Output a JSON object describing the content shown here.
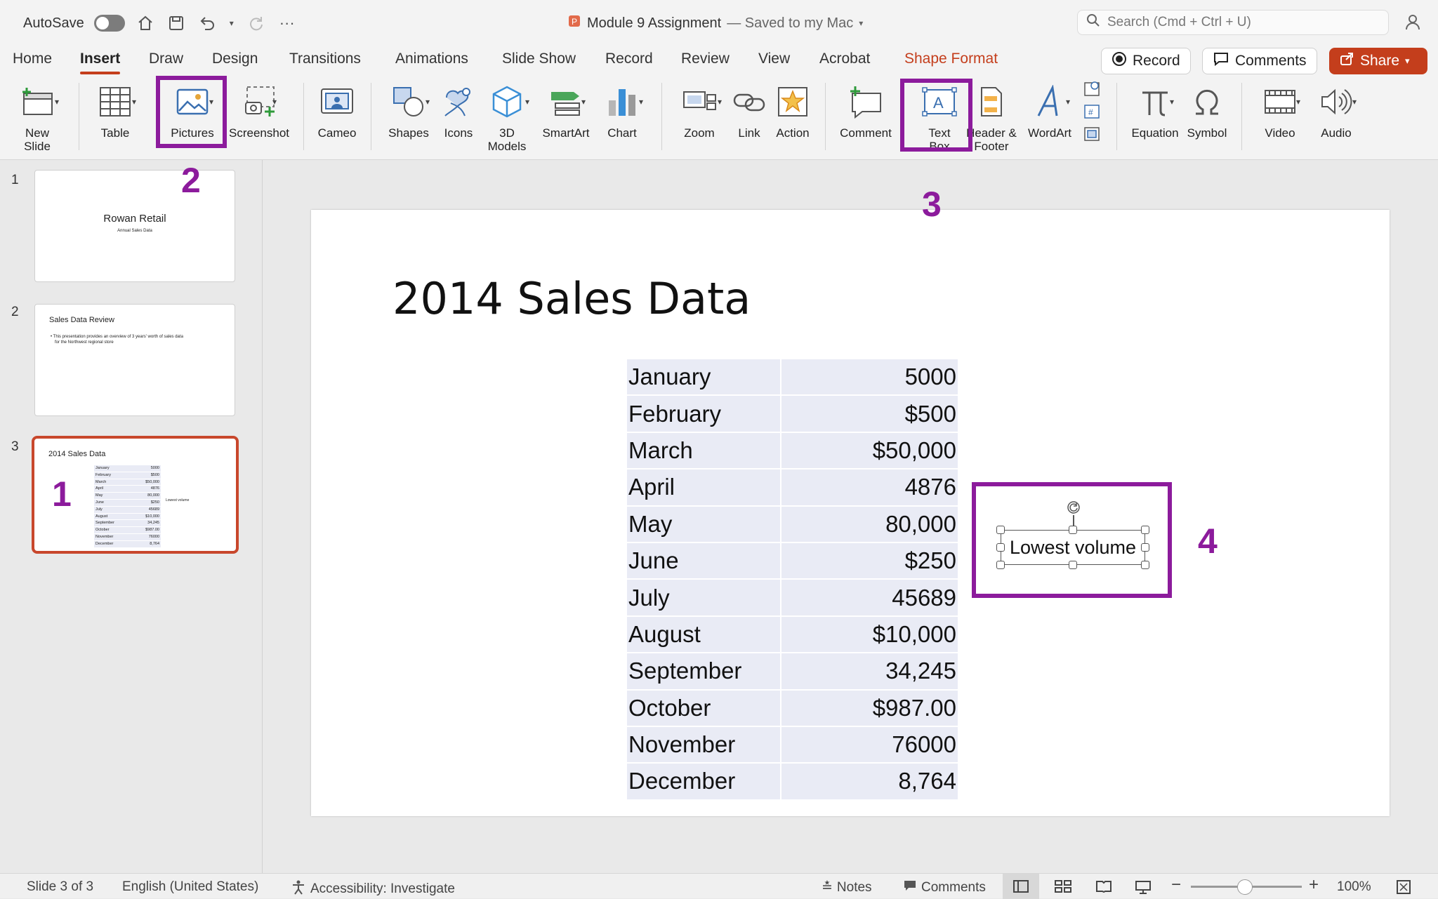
{
  "titlebar": {
    "autosave_label": "AutoSave",
    "doc_name": "Module 9 Assignment",
    "doc_status": "— Saved to my Mac",
    "search_placeholder": "Search (Cmd + Ctrl + U)"
  },
  "tabs": [
    "Home",
    "Insert",
    "Draw",
    "Design",
    "Transitions",
    "Animations",
    "Slide Show",
    "Record",
    "Review",
    "View",
    "Acrobat",
    "Shape Format"
  ],
  "active_tab": "Insert",
  "top_buttons": {
    "record": "Record",
    "comments": "Comments",
    "share": "Share"
  },
  "ribbon": {
    "new_slide": [
      "New",
      "Slide"
    ],
    "table": "Table",
    "pictures": "Pictures",
    "screenshot": "Screenshot",
    "cameo": "Cameo",
    "shapes": "Shapes",
    "icons": "Icons",
    "models": [
      "3D",
      "Models"
    ],
    "smartart": "SmartArt",
    "chart": "Chart",
    "zoom": "Zoom",
    "link": "Link",
    "action": "Action",
    "comment": "Comment",
    "textbox": [
      "Text",
      "Box"
    ],
    "header_footer": [
      "Header &",
      "Footer"
    ],
    "wordart": "WordArt",
    "equation": "Equation",
    "symbol": "Symbol",
    "video": "Video",
    "audio": "Audio"
  },
  "annotations": [
    "1",
    "2",
    "3",
    "4"
  ],
  "annotation_color": "#8c1b9c",
  "thumbnails": [
    {
      "num": "1",
      "title": "Rowan Retail",
      "subtitle": "Annual Sales Data"
    },
    {
      "num": "2",
      "title": "Sales Data Review",
      "bullet": "• This presentation provides an overview of 3 years' worth of sales data",
      "bullet2": "for the Northwest regional store"
    },
    {
      "num": "3",
      "title": "2014 Sales Data",
      "side": "Lowest volume"
    }
  ],
  "slide": {
    "title": "2014 Sales Data",
    "textbox": "Lowest volume",
    "rows": [
      {
        "month": "January",
        "value": "5000"
      },
      {
        "month": "February",
        "value": "$500"
      },
      {
        "month": "March",
        "value": "$50,000"
      },
      {
        "month": "April",
        "value": "4876"
      },
      {
        "month": "May",
        "value": "80,000"
      },
      {
        "month": "June",
        "value": "$250"
      },
      {
        "month": "July",
        "value": "45689"
      },
      {
        "month": "August",
        "value": "$10,000"
      },
      {
        "month": "September",
        "value": "34,245"
      },
      {
        "month": "October",
        "value": "$987.00"
      },
      {
        "month": "November",
        "value": "76000"
      },
      {
        "month": "December",
        "value": "8,764"
      }
    ]
  },
  "statusbar": {
    "slide_count": "Slide 3 of 3",
    "language": "English (United States)",
    "accessibility": "Accessibility: Investigate",
    "notes": "Notes",
    "comments": "Comments",
    "zoom": "100%"
  }
}
